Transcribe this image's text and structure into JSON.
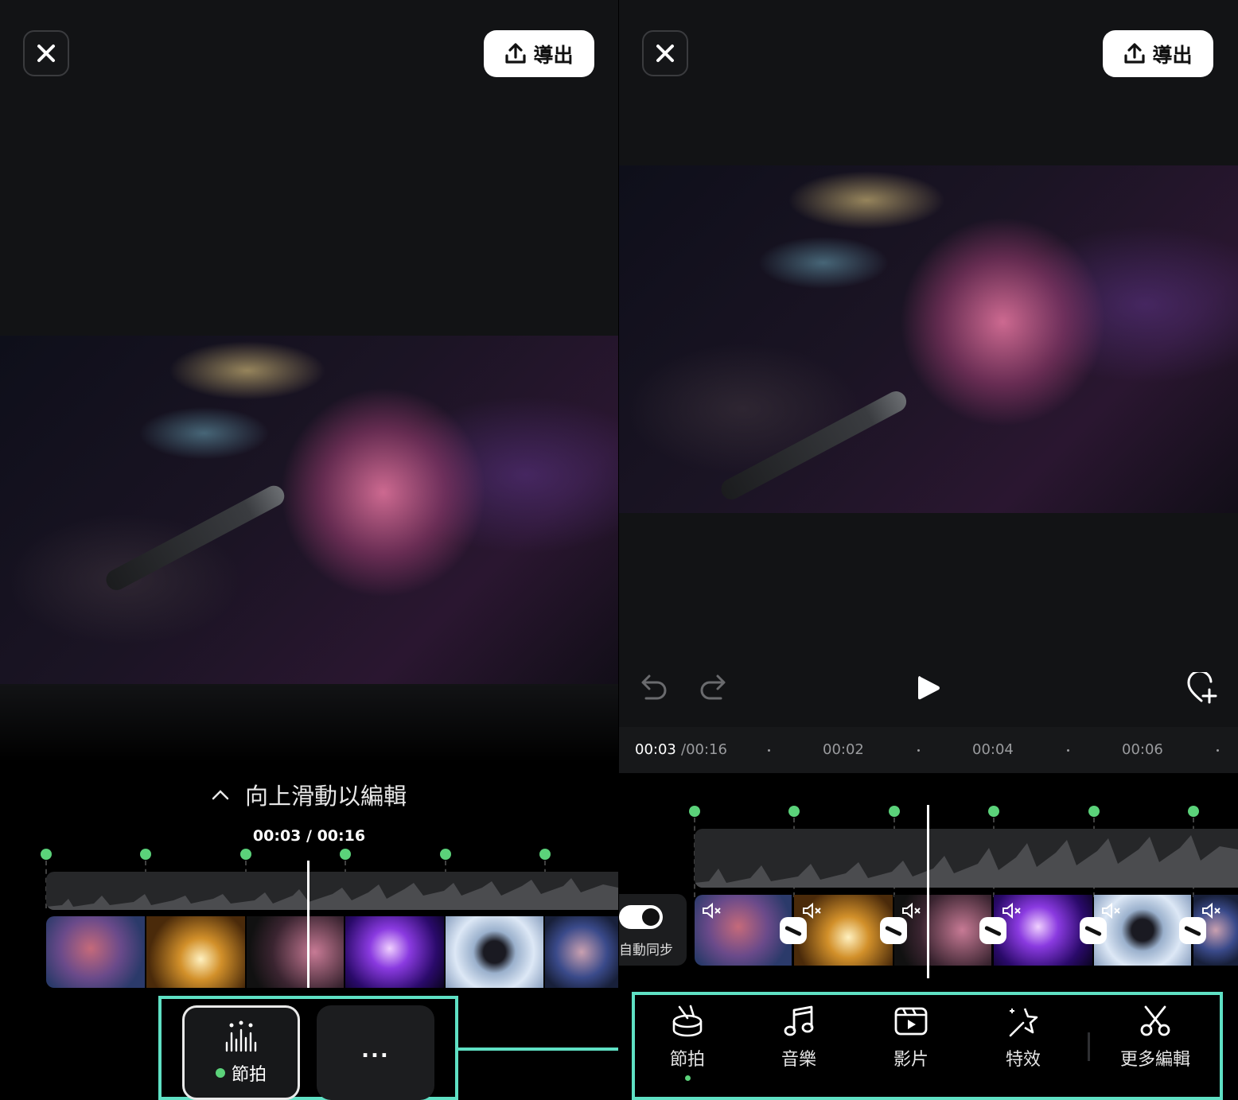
{
  "header": {
    "export_label": "導出"
  },
  "left": {
    "swipe_hint": "向上滑動以編輯",
    "time": "00:03 / 00:16",
    "tools": {
      "beat_label": "節拍",
      "more_label": "..."
    }
  },
  "right": {
    "time_current": "00:03",
    "time_total": "/00:16",
    "ruler_ticks": [
      "00:02",
      "00:04",
      "00:06"
    ],
    "auto_sync_label": "自動同步",
    "tabs": [
      {
        "label": "節拍",
        "icon": "drum-icon"
      },
      {
        "label": "音樂",
        "icon": "music-note-icon"
      },
      {
        "label": "影片",
        "icon": "video-clip-icon"
      },
      {
        "label": "特效",
        "icon": "effects-star-icon"
      },
      {
        "label": "更多編輯",
        "icon": "scissors-icon"
      }
    ]
  },
  "colors": {
    "accent": "#5bd27a",
    "highlight": "#5fe0c4"
  }
}
